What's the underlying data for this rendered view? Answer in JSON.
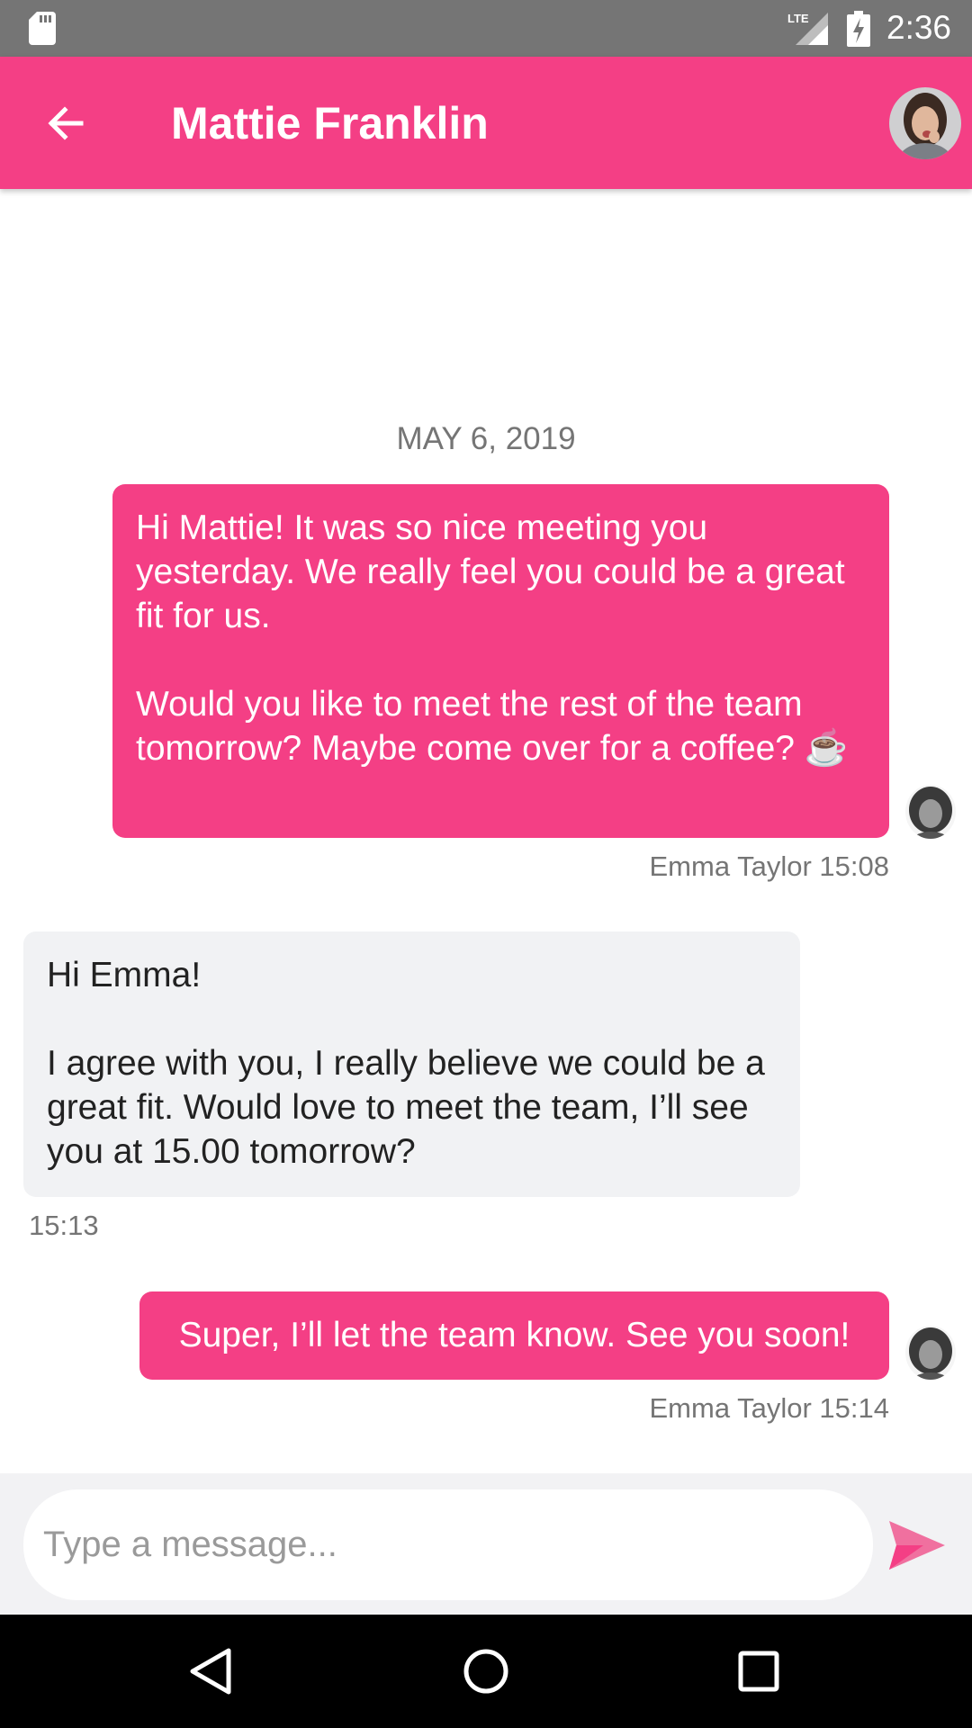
{
  "status_bar": {
    "network_label": "LTE",
    "time": "2:36",
    "icons": [
      "sd-card-icon",
      "lte-signal-icon",
      "battery-charging-icon"
    ]
  },
  "header": {
    "title": "Mattie Franklin",
    "back_icon": "arrow-back-icon",
    "avatar": "contact-avatar"
  },
  "conversation": {
    "date": "MAY 6, 2019",
    "messages": [
      {
        "direction": "outgoing",
        "text": "Hi Mattie! It was so nice meeting you yesterday. We really feel you could be a great fit for us.\n\nWould you like to meet the rest of the team tomorrow? Maybe come over for a coffee? ☕",
        "meta": "Emma Taylor 15:08"
      },
      {
        "direction": "incoming",
        "text": "Hi Emma!\n\nI agree with you, I really believe we could be a great fit. Would love to meet the team, I’ll see you at 15.00 tomorrow?",
        "meta": "15:13"
      },
      {
        "direction": "outgoing",
        "text": "Super, I’ll let the team know. See you soon!",
        "meta": "Emma Taylor 15:14"
      }
    ]
  },
  "composer": {
    "placeholder": "Type a message...",
    "value": "",
    "send_icon": "send-icon"
  },
  "navigation": {
    "icons": [
      "back-triangle-icon",
      "home-circle-icon",
      "recents-square-icon"
    ]
  },
  "colors": {
    "accent": "#F43F85",
    "status_bar": "#757575",
    "incoming_bubble": "#F1F2F4",
    "nav_bar": "#000000"
  }
}
